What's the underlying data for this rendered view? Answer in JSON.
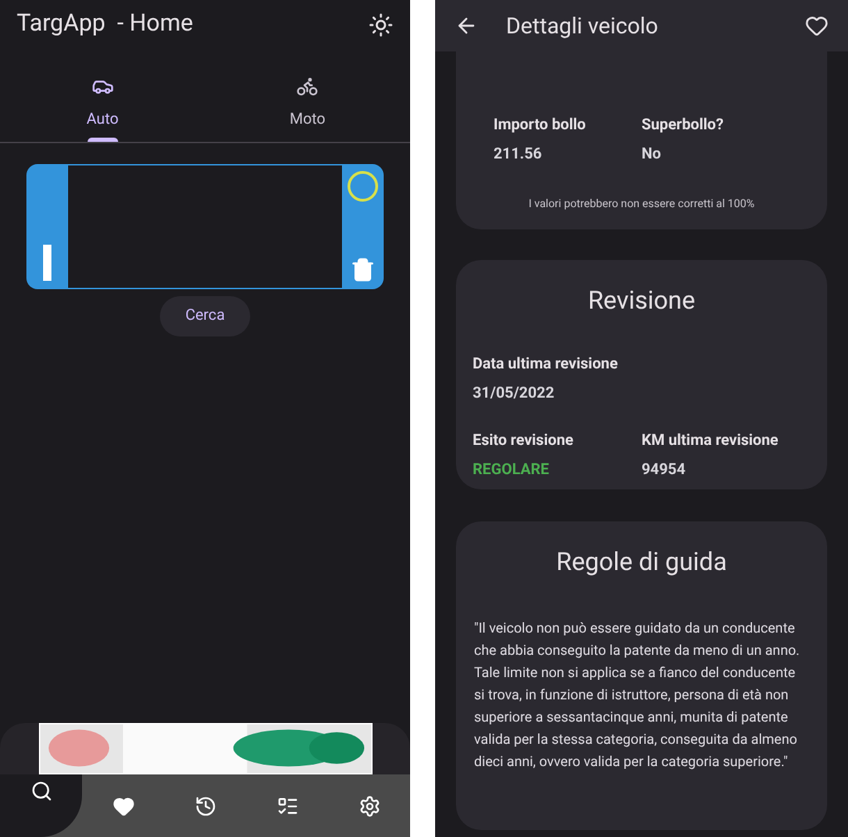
{
  "home": {
    "title": "TargApp  - Home",
    "tabs": [
      {
        "label": "Auto",
        "kind": "car",
        "selected": true
      },
      {
        "label": "Moto",
        "kind": "moto",
        "selected": false
      }
    ],
    "search_button": "Cerca",
    "bottom_nav": [
      {
        "kind": "search",
        "selected": true
      },
      {
        "kind": "favorites",
        "selected": false
      },
      {
        "kind": "history",
        "selected": false
      },
      {
        "kind": "notes",
        "selected": false
      },
      {
        "kind": "settings",
        "selected": false
      }
    ]
  },
  "details": {
    "title": "Dettagli veicolo",
    "tax_card": {
      "fields": [
        {
          "label": "Importo bollo",
          "value": "211.56"
        },
        {
          "label": "Superbollo?",
          "value": "No"
        }
      ],
      "note": "I valori potrebbero non essere corretti al 100%"
    },
    "inspection_card": {
      "title": "Revisione",
      "fields": [
        {
          "label": "Data ultima revisione",
          "value": "31/05/2022"
        },
        {
          "label": "Esito revisione",
          "value": "REGOLARE",
          "kind": "status"
        },
        {
          "label": "KM ultima revisione",
          "value": "94954"
        }
      ]
    },
    "rules_card": {
      "title": "Regole di guida",
      "text": "\"Il veicolo non può essere guidato da un conducente che abbia conseguito la patente da meno di un anno. Tale limite non si applica se a fianco del conducente si trova, in funzione di istruttore, persona di età non superiore a sessantacinque anni, munita di patente valida per la stessa categoria, conseguita da almeno dieci anni, ovvero valida per la categoria superiore.\""
    }
  }
}
